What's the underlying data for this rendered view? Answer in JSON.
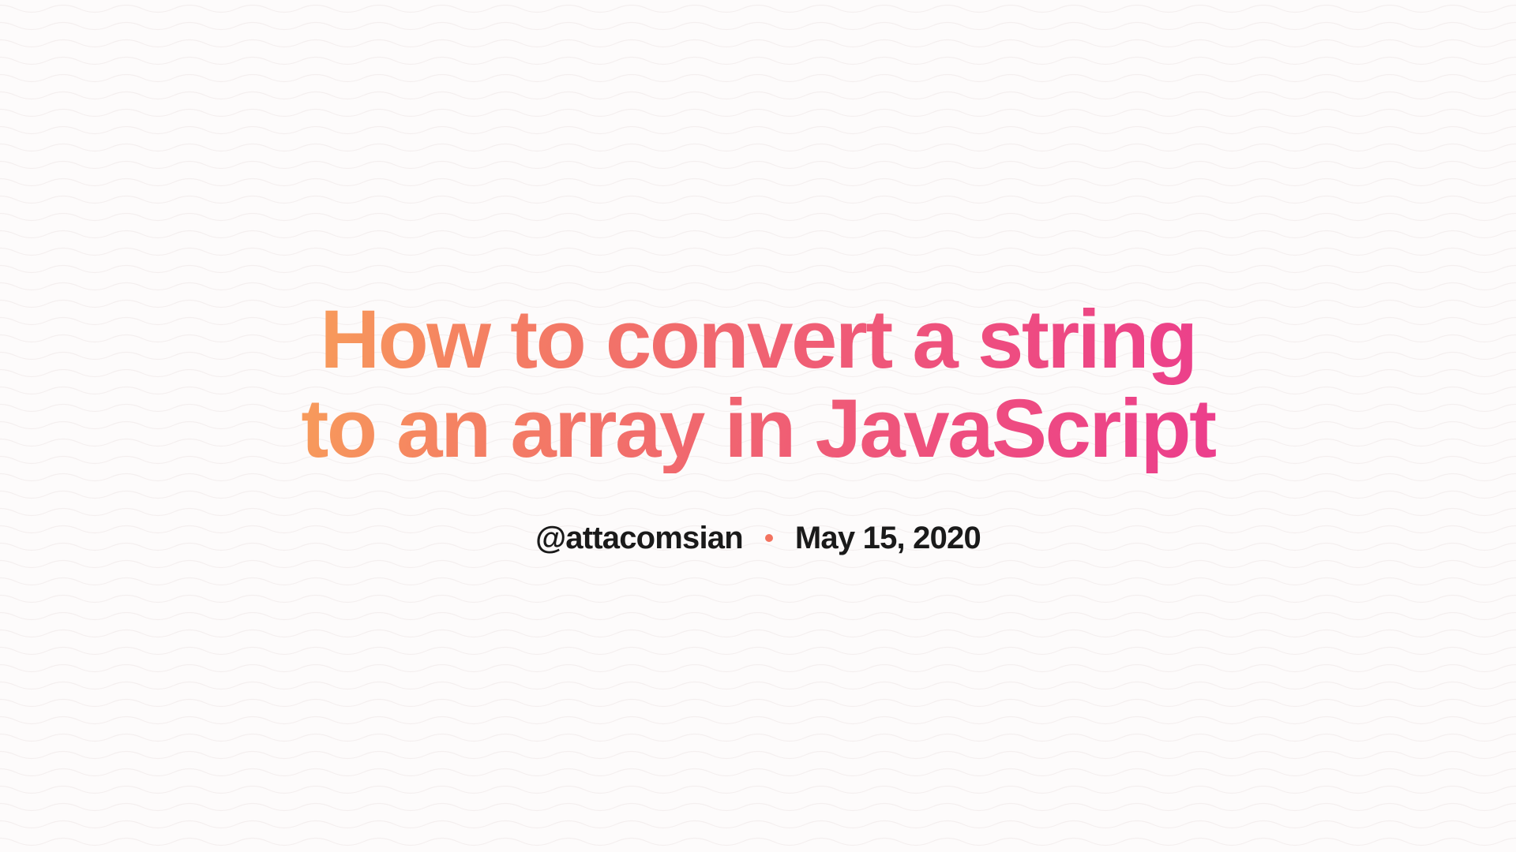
{
  "article": {
    "title": "How to convert a string to an array in JavaScript",
    "author_handle": "@attacomsian",
    "date": "May 15, 2020"
  },
  "colors": {
    "gradient_start": "#f8a15a",
    "gradient_end": "#ec3d8d",
    "text_dark": "#1a1a1a",
    "separator": "#f3735f",
    "background": "#fdfbfb",
    "wave_stroke": "#eee6e6"
  }
}
